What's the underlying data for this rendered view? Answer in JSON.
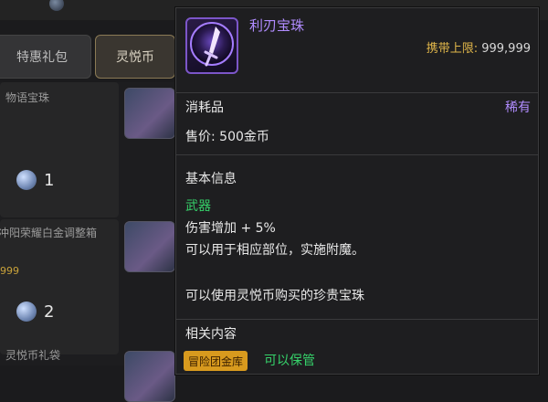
{
  "shop": {
    "tabs": [
      "特惠礼包",
      "灵悦币"
    ],
    "rows": [
      {
        "name": "物语宝珠",
        "qty": "1"
      },
      {
        "name": "冲阳荣耀白金调整箱",
        "qty": "2"
      },
      {
        "name": "灵悦币礼袋",
        "qty": ""
      }
    ],
    "price_hint": "999"
  },
  "tooltip": {
    "item_name": "利刃宝珠",
    "carry_label": "携带上限:",
    "carry_value": "999,999",
    "item_type": "消耗品",
    "rarity": "稀有",
    "price": "售价: 500金币",
    "basic_info_title": "基本信息",
    "weapon": "武器",
    "effect": "伤害增加 + 5%",
    "usage": "可以用于相应部位，实施附魔。",
    "purchase": "可以使用灵悦币购买的珍贵宝珠",
    "related_title": "相关内容",
    "badge": "冒险团金库",
    "storable": "可以保管"
  },
  "colors": {
    "rare_purple": "#b18cff",
    "green": "#36d26a",
    "gold": "#e0b64a",
    "badge_bg": "#d89a1e"
  },
  "icons": [
    "sword-gem-icon",
    "coin-icon"
  ]
}
